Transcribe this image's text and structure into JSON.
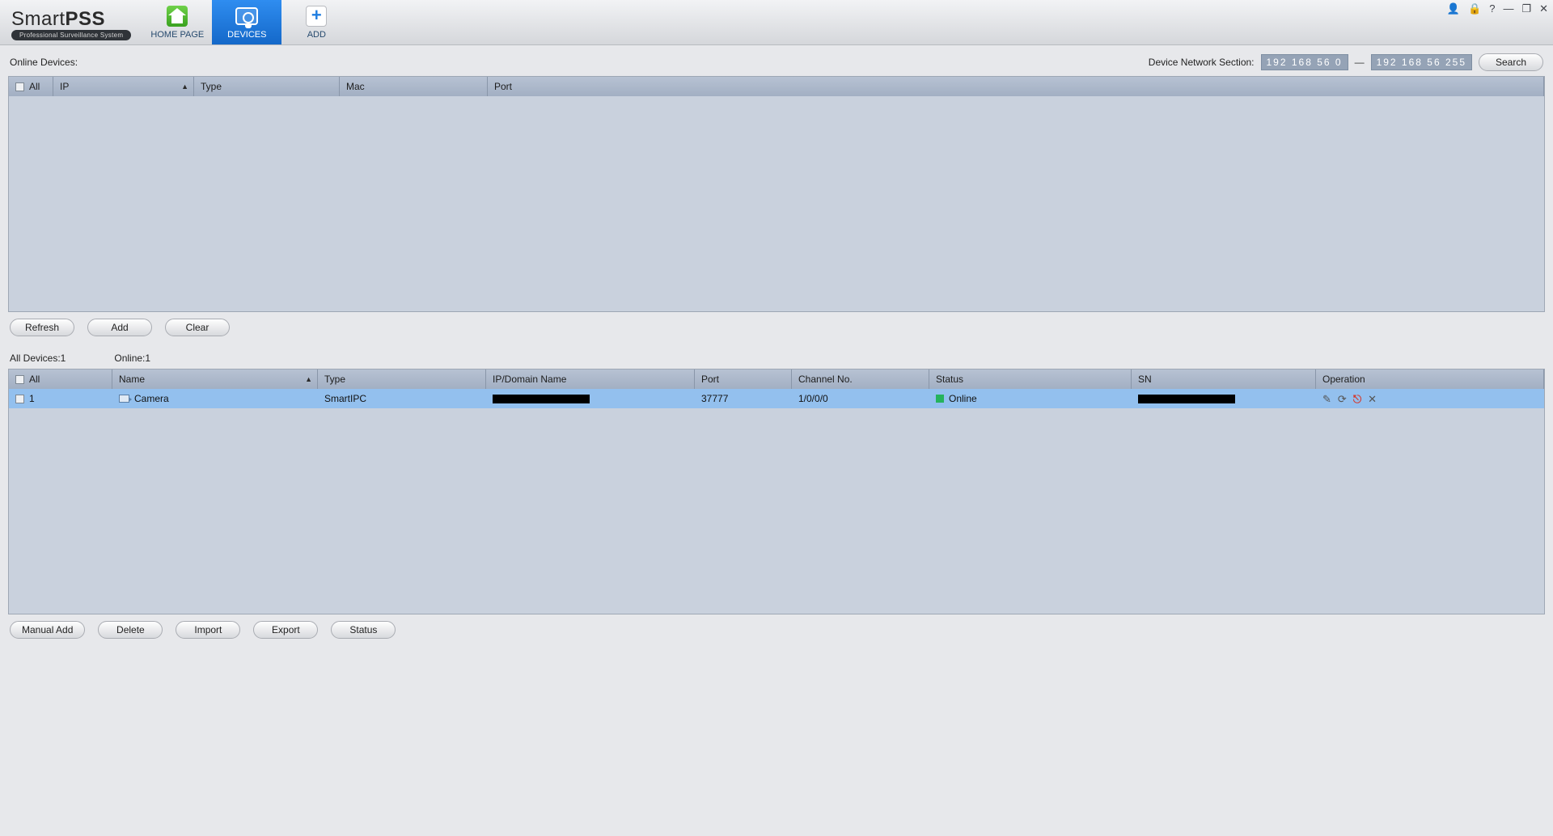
{
  "app": {
    "logo_main_a": "Smart",
    "logo_main_b": "PSS",
    "logo_sub": "Professional Surveillance System"
  },
  "tabs": {
    "home": "HOME PAGE",
    "devices": "DEVICES",
    "add": "ADD"
  },
  "section": {
    "online_label": "Online Devices:",
    "net_label": "Device Network Section:",
    "ip_from": "192  168   56    0",
    "ip_to": "192  168   56  255",
    "search": "Search"
  },
  "online_cols": {
    "all": "All",
    "ip": "IP",
    "type": "Type",
    "mac": "Mac",
    "port": "Port"
  },
  "online_btns": {
    "refresh": "Refresh",
    "add": "Add",
    "clear": "Clear"
  },
  "counts": {
    "all": "All Devices:1",
    "online": "Online:1"
  },
  "all_cols": {
    "all": "All",
    "name": "Name",
    "type": "Type",
    "ipd": "IP/Domain Name",
    "port": "Port",
    "chn": "Channel No.",
    "status": "Status",
    "sn": "SN",
    "op": "Operation"
  },
  "rows": [
    {
      "idx": "1",
      "name": "Camera",
      "type": "SmartIPC",
      "ipd": "████████████████",
      "port": "37777",
      "chn": "1/0/0/0",
      "status": "Online",
      "sn": "████████████████"
    }
  ],
  "bottom_btns": {
    "manual": "Manual Add",
    "delete": "Delete",
    "import": "Import",
    "export": "Export",
    "status": "Status"
  },
  "glyph": {
    "user": "👤",
    "lock": "🔒",
    "help": "?",
    "min": "—",
    "max": "❐",
    "close": "✕",
    "sort": "▲",
    "edit": "✎",
    "refresh": "⟳",
    "logout": "⎋",
    "del": "✕",
    "plus": "+",
    "dash": "—"
  }
}
